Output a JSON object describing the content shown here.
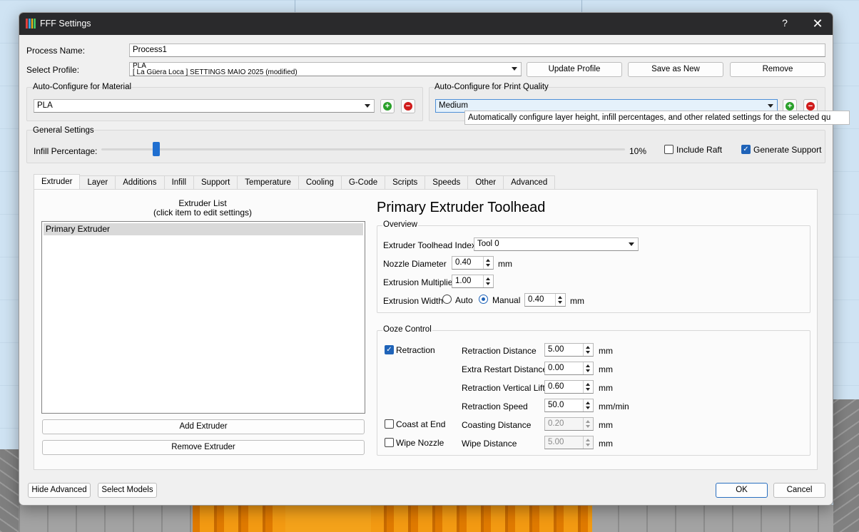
{
  "window": {
    "title": "FFF Settings",
    "help": "?",
    "close": "✕"
  },
  "process": {
    "name_label": "Process Name:",
    "name_value": "Process1"
  },
  "profile": {
    "label": "Select Profile:",
    "value_line1": "PLA",
    "value_line2": "[ La Güera Loca ] SETTINGS MAIO 2025 (modified)",
    "update": "Update Profile",
    "save_as_new": "Save as New",
    "remove": "Remove"
  },
  "material": {
    "title": "Auto-Configure for Material",
    "value": "PLA"
  },
  "quality": {
    "title": "Auto-Configure for Print Quality",
    "value": "Medium"
  },
  "general": {
    "title": "General Settings",
    "infill_label": "Infill Percentage:",
    "infill_value": "10%",
    "infill_fraction": 0.1,
    "include_raft": "Include Raft",
    "include_raft_checked": false,
    "generate_support": "Generate Support",
    "generate_support_checked": true
  },
  "tooltip": "Automatically configure layer height, infill percentages, and other related settings for the selected qu",
  "tabs": [
    "Extruder",
    "Layer",
    "Additions",
    "Infill",
    "Support",
    "Temperature",
    "Cooling",
    "G-Code",
    "Scripts",
    "Speeds",
    "Other",
    "Advanced"
  ],
  "extruder_list": {
    "title": "Extruder List",
    "subtitle": "(click item to edit settings)",
    "items": [
      "Primary Extruder"
    ],
    "add": "Add Extruder",
    "remove": "Remove Extruder"
  },
  "toolhead": {
    "heading": "Primary Extruder Toolhead",
    "overview_title": "Overview",
    "index_label": "Extruder Toolhead Index",
    "index_value": "Tool 0",
    "nozzle_label": "Nozzle Diameter",
    "nozzle_value": "0.40",
    "nozzle_unit": "mm",
    "mult_label": "Extrusion Multiplier",
    "mult_value": "1.00",
    "width_label": "Extrusion Width",
    "auto": "Auto",
    "manual": "Manual",
    "width_value": "0.40",
    "width_unit": "mm"
  },
  "ooze": {
    "title": "Ooze Control",
    "retraction": "Retraction",
    "retraction_checked": true,
    "coast": "Coast at End",
    "coast_checked": false,
    "wipe": "Wipe Nozzle",
    "wipe_checked": false,
    "rows": [
      {
        "label": "Retraction Distance",
        "value": "5.00",
        "unit": "mm",
        "disabled": false
      },
      {
        "label": "Extra Restart Distance",
        "value": "0.00",
        "unit": "mm",
        "disabled": false
      },
      {
        "label": "Retraction Vertical Lift",
        "value": "0.60",
        "unit": "mm",
        "disabled": false
      },
      {
        "label": "Retraction Speed",
        "value": "50.0",
        "unit": "mm/min",
        "disabled": false
      },
      {
        "label": "Coasting Distance",
        "value": "0.20",
        "unit": "mm",
        "disabled": true
      },
      {
        "label": "Wipe Distance",
        "value": "5.00",
        "unit": "mm",
        "disabled": true
      }
    ]
  },
  "footer": {
    "hide_advanced": "Hide Advanced",
    "select_models": "Select Models",
    "ok": "OK",
    "cancel": "Cancel"
  }
}
